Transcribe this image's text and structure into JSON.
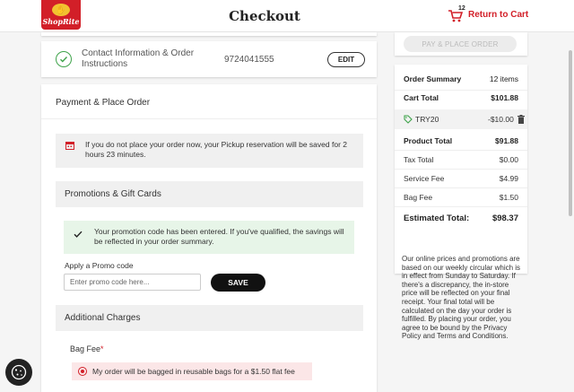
{
  "header": {
    "logo_text": "ShopRite",
    "title": "Checkout",
    "cart_count": "12",
    "return_label": "Return to Cart"
  },
  "contact": {
    "label": "Contact Information & Order Instructions",
    "phone": "9724041555",
    "edit_label": "EDIT"
  },
  "payment": {
    "title": "Payment & Place Order",
    "notice": "If you do not place your order now, your Pickup reservation will be saved for 2 hours 23 minutes.",
    "promotions_title": "Promotions & Gift Cards",
    "promo_success": "Your promotion code has been entered. If you've qualified, the savings will be reflected in your order summary.",
    "promo_label": "Apply a Promo code",
    "promo_placeholder": "Enter promo code here...",
    "save_label": "SAVE",
    "charges_title": "Additional Charges",
    "bag_fee_label": "Bag Fee",
    "required_mark": "*",
    "bag_option": "My order will be bagged in reusable bags for a $1.50 flat fee"
  },
  "summary": {
    "place_order_label": "PAY & PLACE ORDER",
    "title": "Order Summary",
    "items": "12 items",
    "cart_total_label": "Cart Total",
    "cart_total": "$101.88",
    "promo_code": "TRY20",
    "promo_discount": "-$10.00",
    "product_total_label": "Product Total",
    "product_total": "$91.88",
    "tax_label": "Tax Total",
    "tax": "$0.00",
    "service_fee_label": "Service Fee",
    "service_fee": "$4.99",
    "bag_fee_label": "Bag Fee",
    "bag_fee": "$1.50",
    "estimated_label": "Estimated Total:",
    "estimated": "$98.37"
  },
  "disclaimer": "Our online prices and promotions are based on our weekly circular which is in effect from Sunday to Saturday. If there's a discrepancy, the in-store price will be reflected on your final receipt. Your final total will be calculated on the day your order is fulfilled. By placing your order, you agree to be bound by the Privacy Policy and Terms and Conditions.",
  "colors": {
    "brand_red": "#d21f28",
    "success_green": "#3ea34a"
  }
}
